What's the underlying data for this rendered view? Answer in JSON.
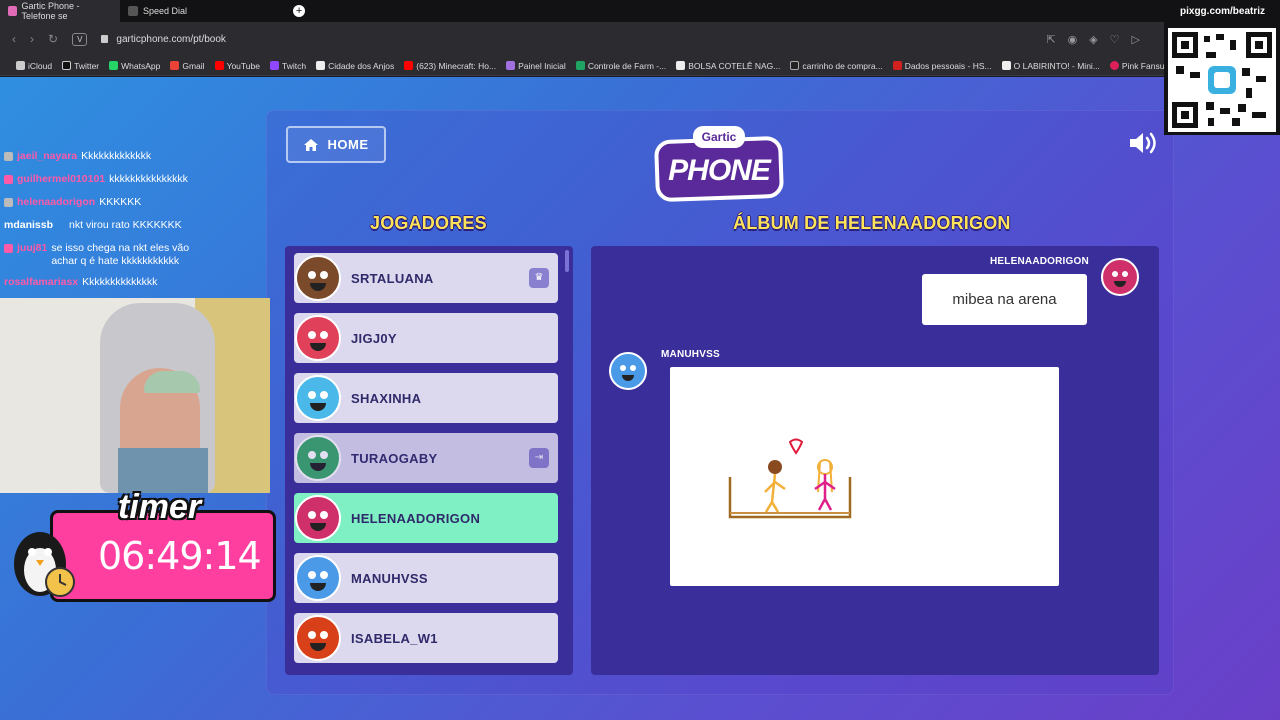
{
  "browser": {
    "tabs": [
      {
        "label": "Gartic Phone - Telefone se",
        "active": true
      },
      {
        "label": "Speed Dial",
        "active": false
      }
    ],
    "url": "garticphone.com/pt/book",
    "bookmarks": [
      "iCloud",
      "Twitter",
      "WhatsApp",
      "Gmail",
      "YouTube",
      "Twitch",
      "Cidade dos Anjos",
      "(623) Minecraft: Ho...",
      "Painel Inicial",
      "Controle de Farm -...",
      "BOLSA COTELÊ NAG...",
      "carrinho de compra...",
      "Dados pessoais - HS...",
      "O LABIRINTO! - Mini...",
      "Pink Fansub"
    ]
  },
  "game": {
    "home_label": "HOME",
    "logo_top": "Gartic",
    "logo_bottom": "PHONE",
    "players_title": "JOGADORES",
    "album_title": "ÁLBUM DE HELENAADORIGON",
    "players": [
      {
        "name": "SRTALUANA",
        "badge": "♛",
        "color": "#7a4a2a"
      },
      {
        "name": "JIGJ0Y",
        "badge": "",
        "color": "#e0405a"
      },
      {
        "name": "SHAXINHA",
        "badge": "",
        "color": "#4ab8e8"
      },
      {
        "name": "TURAOGABY",
        "badge": "⇥",
        "color": "#3aa86a"
      },
      {
        "name": "HELENAADORIGON",
        "badge": "",
        "color": "#d0306a"
      },
      {
        "name": "MANUHVSS",
        "badge": "",
        "color": "#4a9ae8"
      },
      {
        "name": "ISABELA_W1",
        "badge": "",
        "color": "#d8401a"
      }
    ],
    "album": {
      "author1": "HELENAADORIGON",
      "phrase": "mibea na arena",
      "author2": "MANUHVSS"
    }
  },
  "stream": {
    "chat": [
      {
        "user": "jaeil_nayara",
        "msg": "Kkkkkkkkkkkkk",
        "color": "#ff5aa8"
      },
      {
        "user": "guilhermel010101",
        "msg": "kkkkkkkkkkkkkkk",
        "color": "#ff5aa8"
      },
      {
        "user": "helenaadorigon",
        "msg": "KKKKKK",
        "color": "#ff5aa8"
      },
      {
        "user": "mdanissb",
        "msg": "nkt virou rato KKKKKKK",
        "color": "#ffffff"
      },
      {
        "user": "juuj81",
        "msg": "se isso chega na nkt eles vão achar q é hate kkkkkkkkkkk",
        "color": "#ff5aa8"
      },
      {
        "user": "rosalfamariasx",
        "msg": "Kkkkkkkkkkkkkk",
        "color": "#ff5aa8"
      }
    ],
    "timer_label": "timer",
    "timer_value": "06:49:14",
    "qr_title": "pixgg.com/beatriz"
  },
  "colors": {
    "accent_yellow": "#ffe45a",
    "panel": "#3a2e9a",
    "active_player": "#7ef0c4",
    "timer_pink": "#ff3fa0"
  }
}
